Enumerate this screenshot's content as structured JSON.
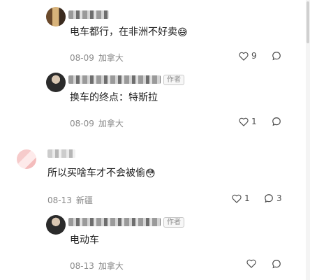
{
  "comments": [
    {
      "text": "电车都行，在非洲不好卖",
      "emoji": "😅",
      "date": "08-09",
      "location": "加拿大",
      "likes": "9"
    },
    {
      "author_tag": "作者",
      "text": "换车的终点：特斯拉",
      "date": "08-09",
      "location": "加拿大",
      "likes": "1"
    },
    {
      "text": "所以买啥车才不会被偷",
      "emoji": "😳",
      "date": "08-13",
      "location": "新疆",
      "likes": "1",
      "replies": "3"
    },
    {
      "author_tag": "作者",
      "text": "电动车",
      "date": "08-13",
      "location": "加拿大",
      "likes": ""
    }
  ],
  "icons": {
    "like": "heart-outline",
    "reply": "speech-bubble"
  },
  "colors": {
    "meta": "#8a8a8a",
    "text": "#1c1c1c",
    "tag_border": "#c8c8c8"
  }
}
